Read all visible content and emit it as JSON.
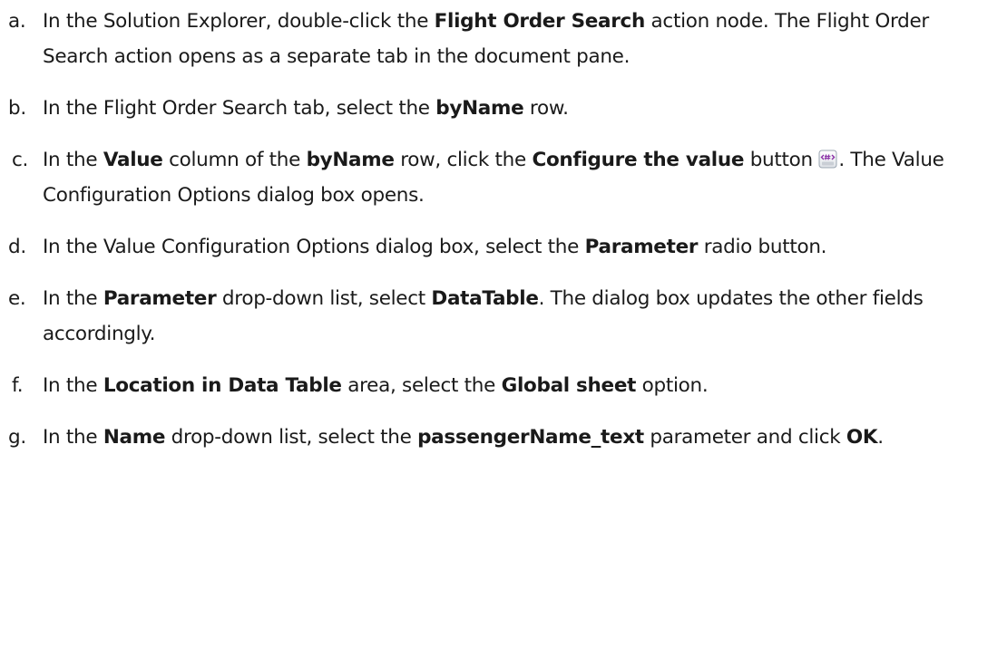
{
  "steps": [
    {
      "marker": "a.",
      "parts": [
        {
          "t": "In the Solution Explorer, double-click the "
        },
        {
          "t": "Flight Order Search",
          "b": true
        },
        {
          "t": " action node. The Flight Order Search action opens as a separate tab in the document pane."
        }
      ]
    },
    {
      "marker": "b.",
      "parts": [
        {
          "t": "In the Flight Order Search tab, select the "
        },
        {
          "t": "byName",
          "b": true
        },
        {
          "t": " row."
        }
      ]
    },
    {
      "marker": "c.",
      "parts": [
        {
          "t": "In the "
        },
        {
          "t": "Value",
          "b": true
        },
        {
          "t": " column of the "
        },
        {
          "t": "byName",
          "b": true
        },
        {
          "t": " row, click the "
        },
        {
          "t": "Configure the value",
          "b": true
        },
        {
          "t": " button "
        },
        {
          "icon": "configure-value-icon"
        },
        {
          "t": ". The Value Configuration Options dialog box opens."
        }
      ]
    },
    {
      "marker": "d.",
      "parts": [
        {
          "t": "In the Value Configuration Options dialog box, select the "
        },
        {
          "t": "Parameter",
          "b": true
        },
        {
          "t": " radio button."
        }
      ]
    },
    {
      "marker": "e.",
      "parts": [
        {
          "t": "In the "
        },
        {
          "t": "Parameter",
          "b": true
        },
        {
          "t": " drop-down list, select "
        },
        {
          "t": "DataTable",
          "b": true
        },
        {
          "t": ". The dialog box updates the other fields accordingly."
        }
      ]
    },
    {
      "marker": "f.",
      "parts": [
        {
          "t": "In the "
        },
        {
          "t": "Location in Data Table",
          "b": true
        },
        {
          "t": " area, select the "
        },
        {
          "t": "Global sheet",
          "b": true
        },
        {
          "t": " option."
        }
      ]
    },
    {
      "marker": "g.",
      "parts": [
        {
          "t": "In the "
        },
        {
          "t": "Name",
          "b": true
        },
        {
          "t": " drop-down list, select the "
        },
        {
          "t": "passengerName_text",
          "b": true
        },
        {
          "t": " parameter and click "
        },
        {
          "t": "OK",
          "b": true
        },
        {
          "t": "."
        }
      ]
    }
  ],
  "colors": {
    "text": "#1a1a1a",
    "icon_accent": "#8b2fa6",
    "icon_frame": "#9aa4b0"
  }
}
